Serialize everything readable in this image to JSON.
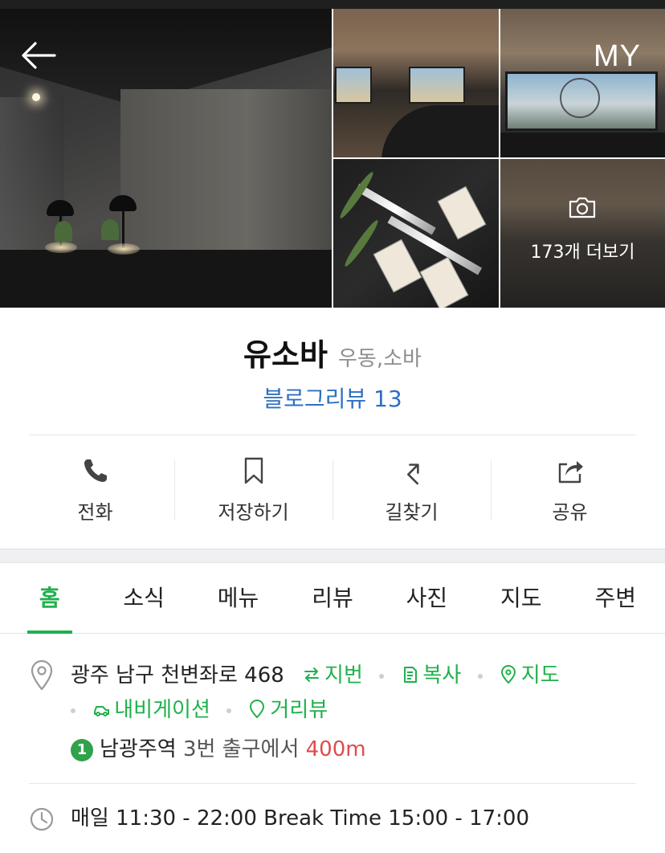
{
  "nav": {
    "my_label": "MY"
  },
  "gallery": {
    "more_label": "173개 더보기"
  },
  "place": {
    "name": "유소바",
    "category": "우동,소바",
    "blog_review": "블로그리뷰 13"
  },
  "actions": [
    {
      "label": "전화",
      "icon": "phone-icon"
    },
    {
      "label": "저장하기",
      "icon": "bookmark-icon"
    },
    {
      "label": "길찾기",
      "icon": "directions-icon"
    },
    {
      "label": "공유",
      "icon": "share-icon"
    }
  ],
  "tabs": [
    {
      "label": "홈",
      "active": true
    },
    {
      "label": "소식",
      "active": false
    },
    {
      "label": "메뉴",
      "active": false
    },
    {
      "label": "리뷰",
      "active": false
    },
    {
      "label": "사진",
      "active": false
    },
    {
      "label": "지도",
      "active": false
    },
    {
      "label": "주변",
      "active": false
    }
  ],
  "info": {
    "address": "광주 남구 천변좌로 468",
    "links": {
      "lot_number": "지번",
      "copy": "복사",
      "map": "지도",
      "navigation": "내비게이션",
      "street_view": "거리뷰"
    },
    "subway": {
      "line": "1",
      "station": "남광주역",
      "exit": "3번 출구에서",
      "distance": "400m"
    },
    "hours": "매일 11:30 - 22:00 Break Time 15:00 - 17:00"
  },
  "colors": {
    "accent_green": "#1fb14b",
    "link_blue": "#2f6fc0",
    "distance_red": "#e04b4b",
    "subway_line_1": "#2fa24a"
  }
}
